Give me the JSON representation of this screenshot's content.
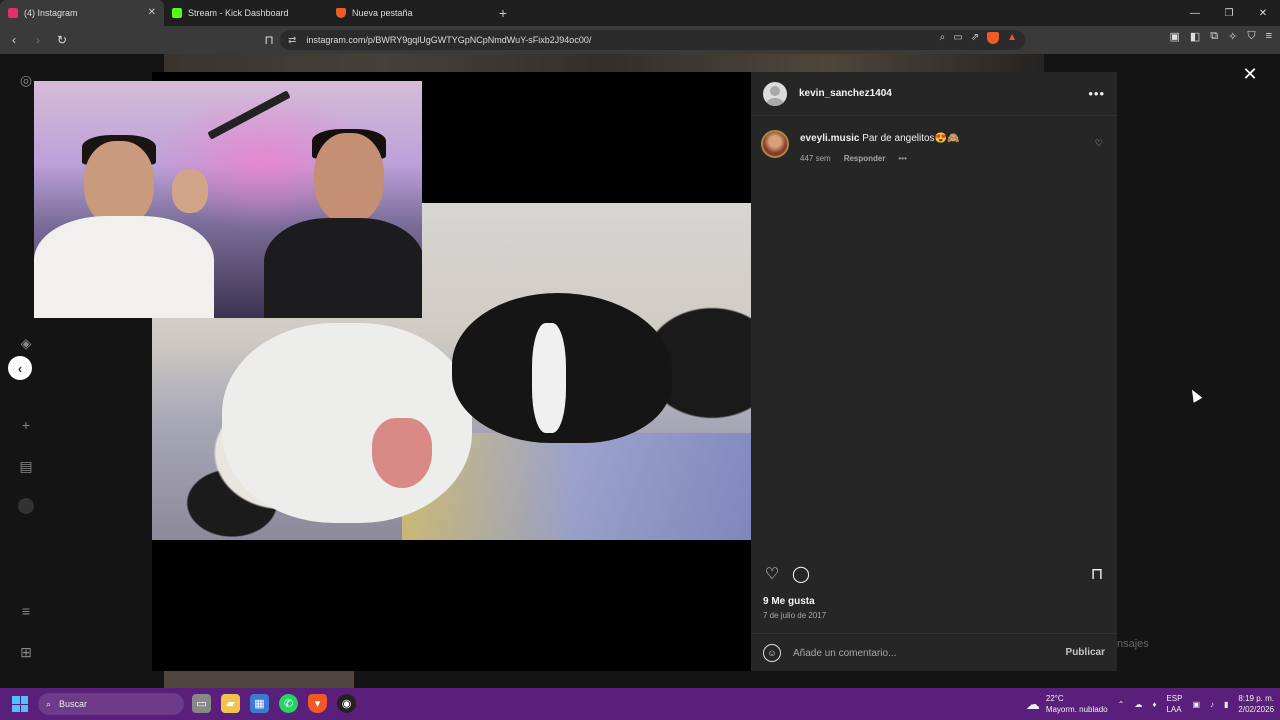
{
  "browser": {
    "tabs": [
      {
        "label": "(4) Instagram",
        "color": "#e1306c",
        "active": true
      },
      {
        "label": "Stream - Kick Dashboard",
        "color": "#53fc18",
        "active": false
      },
      {
        "label": "Nueva pestaña",
        "color": "#f05a24",
        "active": false
      }
    ],
    "url": "instagram.com/p/BWRY9gqlUgGWTYGpNCpNmdWuY-sFixb2J94oc00/",
    "brave_badge": "4"
  },
  "post": {
    "username": "kevin_sanchez1404",
    "comment": {
      "user": "eveyli.music",
      "text": "Par de angelitos😍🙈",
      "time": "447 sem",
      "reply": "Responder"
    },
    "likes": "9 Me gusta",
    "date": "7 de julio de 2017",
    "comment_placeholder": "Añade un comentario...",
    "publish_label": "Publicar"
  },
  "background": {
    "messages_ghost": "nsajes"
  },
  "taskbar": {
    "search_placeholder": "Buscar",
    "weather_temp": "22°C",
    "weather_desc": "Mayorm. nublado",
    "lang_top": "ESP",
    "lang_bottom": "LAA",
    "time": "8:19 p. m.",
    "date": "2/02/2026"
  },
  "colors": {
    "taskbar": "#5a1f7a",
    "panel_bg": "#262626",
    "accent": "#e1306c"
  }
}
